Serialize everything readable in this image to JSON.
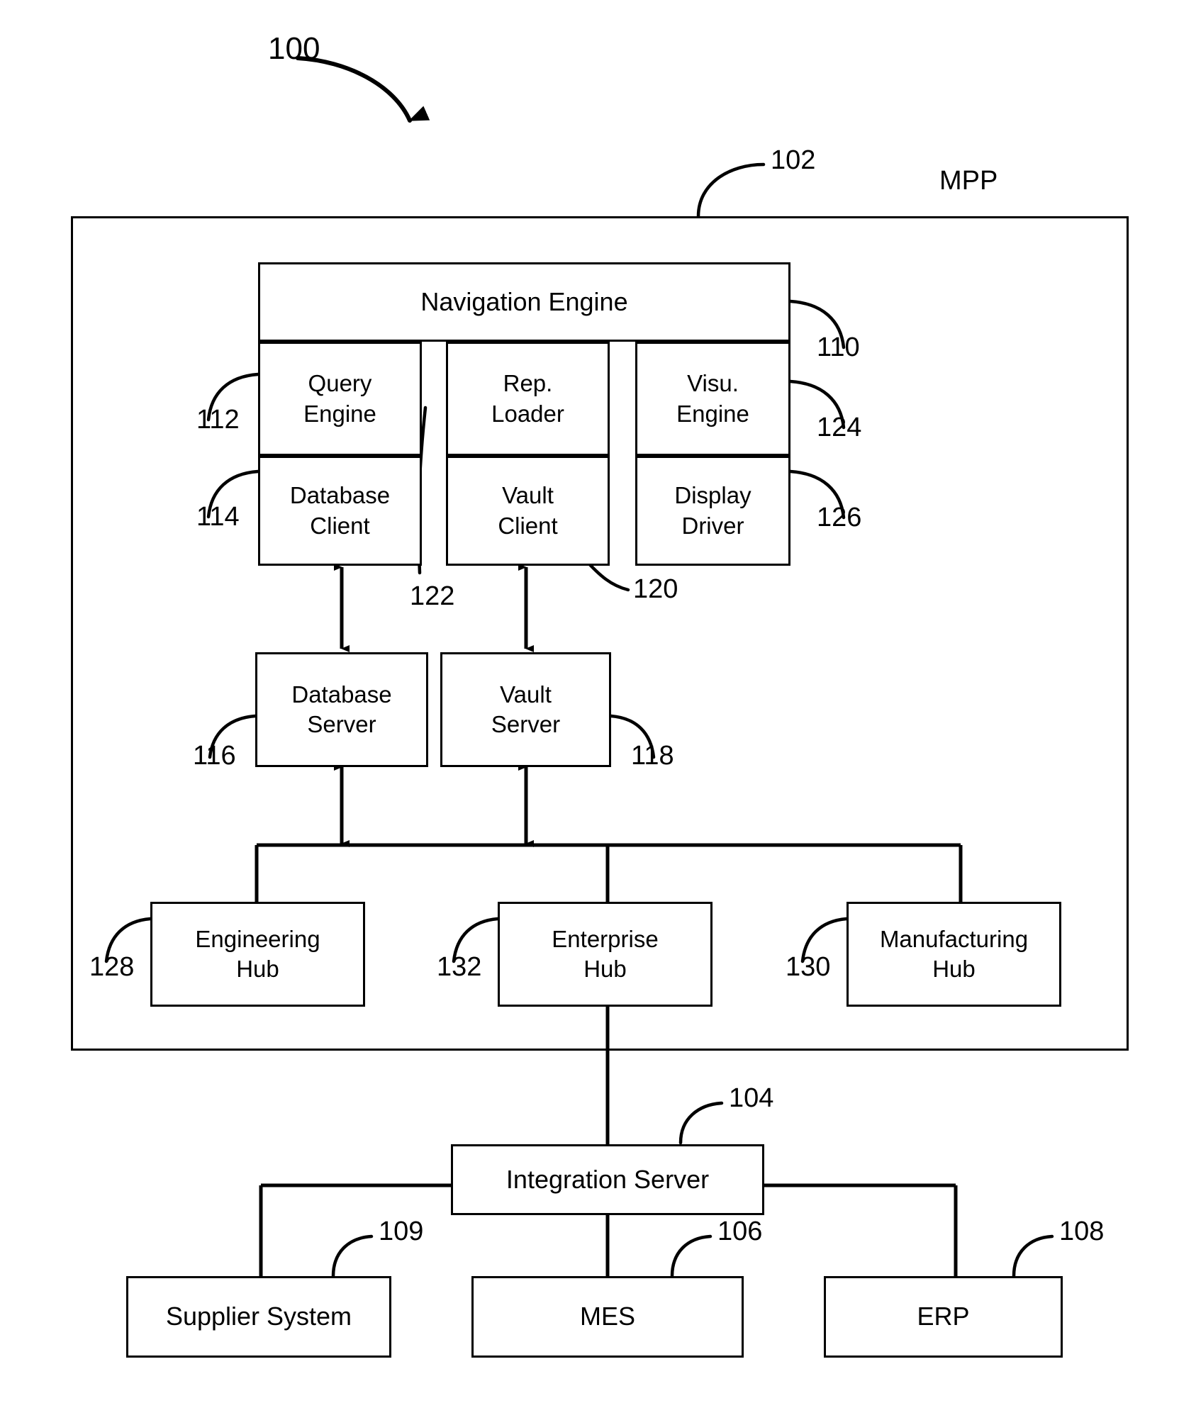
{
  "figure": {
    "figure_ref": "100",
    "system_label": "MPP",
    "system_ref": "102"
  },
  "mpp_container": {
    "label": "MPP",
    "ref": "102"
  },
  "navigation_engine": {
    "label": "Navigation Engine",
    "ref": "110"
  },
  "modules": {
    "query_engine": {
      "label": "Query\nEngine",
      "ref": "112"
    },
    "database_client": {
      "label": "Database\nClient",
      "ref": "114"
    },
    "rep_loader": {
      "label": "Rep.\nLoader",
      "ref": "122"
    },
    "vault_client": {
      "label": "Vault\nClient",
      "ref": "120"
    },
    "visu_engine": {
      "label": "Visu.\nEngine",
      "ref": "124"
    },
    "display_driver": {
      "label": "Display\nDriver",
      "ref": "126"
    }
  },
  "servers": {
    "database_server": {
      "label": "Database\nServer",
      "ref": "116"
    },
    "vault_server": {
      "label": "Vault\nServer",
      "ref": "118"
    }
  },
  "hubs": {
    "engineering_hub": {
      "label": "Engineering\nHub",
      "ref": "128"
    },
    "enterprise_hub": {
      "label": "Enterprise\nHub",
      "ref": "132"
    },
    "manufacturing_hub": {
      "label": "Manufacturing\nHub",
      "ref": "130"
    }
  },
  "integration": {
    "integration_server": {
      "label": "Integration Server",
      "ref": "104"
    }
  },
  "external_systems": {
    "supplier_system": {
      "label": "Supplier System",
      "ref": "109"
    },
    "mes": {
      "label": "MES",
      "ref": "106"
    },
    "erp": {
      "label": "ERP",
      "ref": "108"
    }
  },
  "colors": {
    "stroke": "#000000",
    "background": "#ffffff"
  }
}
